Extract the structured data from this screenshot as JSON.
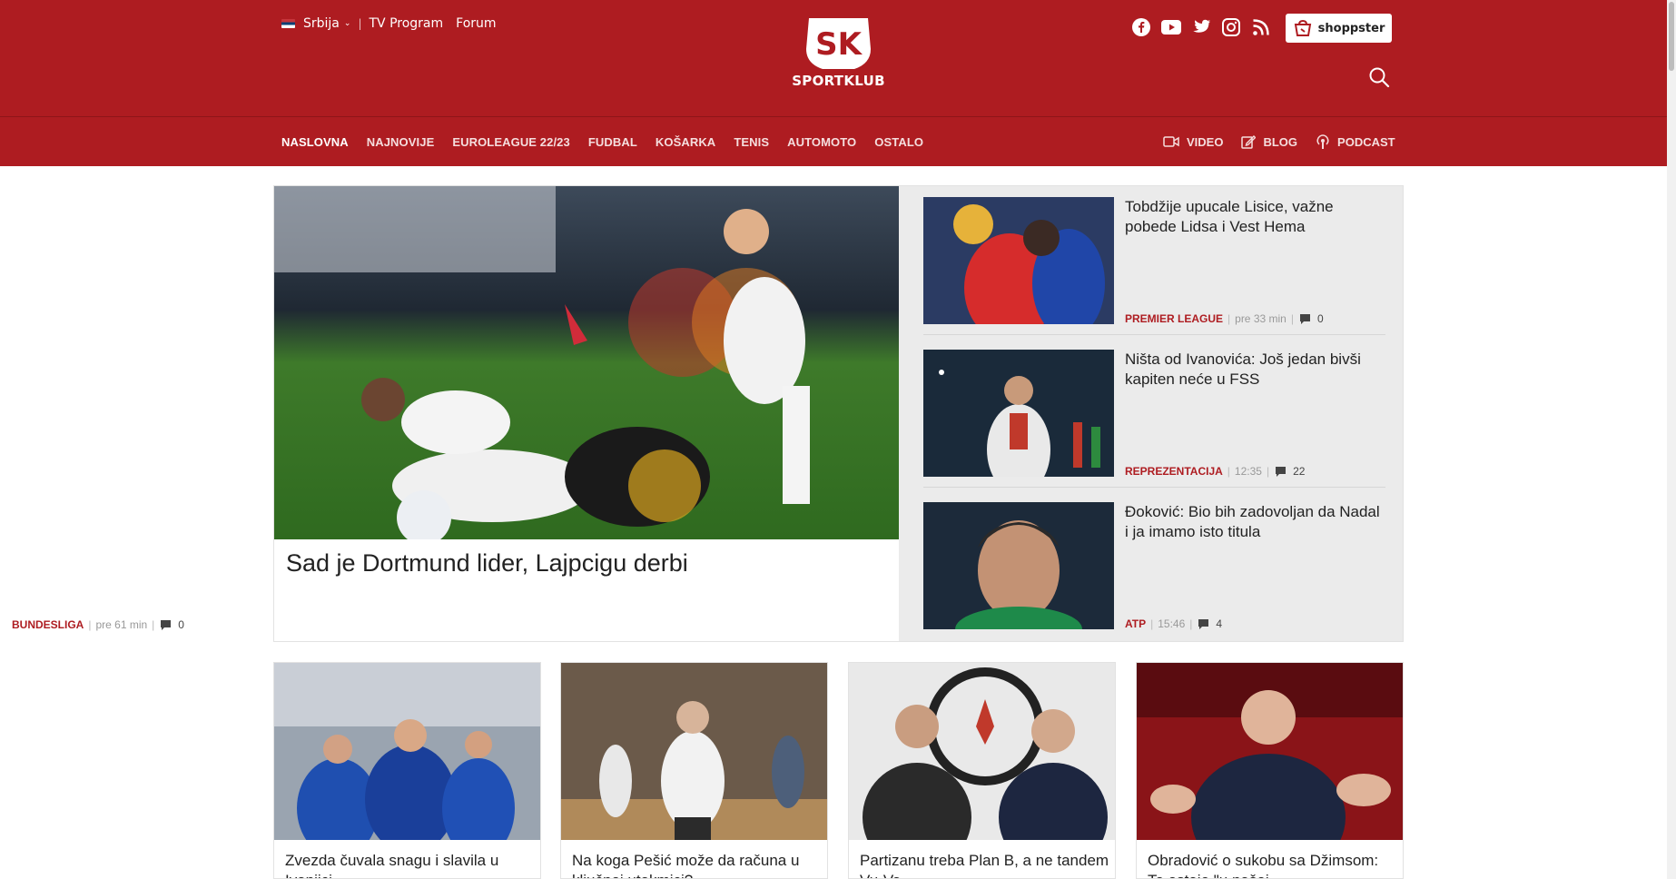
{
  "header": {
    "region": "Srbija",
    "links": [
      "TV Program",
      "Forum"
    ],
    "logo_text": "SPORTKLUB",
    "logo_letters": "SK",
    "shoppster_label": "shoppster",
    "social_icons": [
      "facebook-icon",
      "youtube-icon",
      "twitter-icon",
      "instagram-icon",
      "rss-icon"
    ],
    "colors": {
      "brand_red": "#ae1c21",
      "category_red": "#ae1c21",
      "side_bg": "#ebebeb"
    }
  },
  "nav": {
    "items": [
      {
        "label": "NASLOVNA",
        "active": true
      },
      {
        "label": "NAJNOVIJE",
        "active": false
      },
      {
        "label": "EUROLEAGUE 22/23",
        "active": false
      },
      {
        "label": "FUDBAL",
        "active": false
      },
      {
        "label": "KOŠARKA",
        "active": false
      },
      {
        "label": "TENIS",
        "active": false
      },
      {
        "label": "AUTOMOTO",
        "active": false
      },
      {
        "label": "OSTALO",
        "active": false
      }
    ],
    "right": [
      {
        "label": "VIDEO",
        "icon": "video-icon"
      },
      {
        "label": "BLOG",
        "icon": "edit-icon"
      },
      {
        "label": "PODCAST",
        "icon": "podcast-icon"
      }
    ]
  },
  "hero": {
    "title": "Sad je Dortmund lider, Lajpcigu derbi",
    "category": "BUNDESLIGA",
    "time": "pre 61 min",
    "comments": "0"
  },
  "side": [
    {
      "title": "Tobdžije upucale Lisice, važne pobede Lidsa i Vest Hema",
      "category": "PREMIER LEAGUE",
      "time": "pre 33 min",
      "comments": "0"
    },
    {
      "title": "Ništa od Ivanovića: Još jedan bivši kapiten neće u FSS",
      "category": "REPREZENTACIJA",
      "time": "12:35",
      "comments": "22"
    },
    {
      "title": "Đoković: Bio bih zadovoljan da Nadal i ja imamo isto titula",
      "category": "ATP",
      "time": "15:46",
      "comments": "4"
    }
  ],
  "cards": [
    {
      "title": "Zvezda čuvala snagu i slavila u Ivanjici"
    },
    {
      "title": "Na koga Pešić može da računa u ključnoj utakmici?"
    },
    {
      "title": "Partizanu treba Plan B, a ne tandem Vu-Va"
    },
    {
      "title": "Obradović o sukobu sa Džimsom: To ostaje \"u našoj"
    }
  ]
}
